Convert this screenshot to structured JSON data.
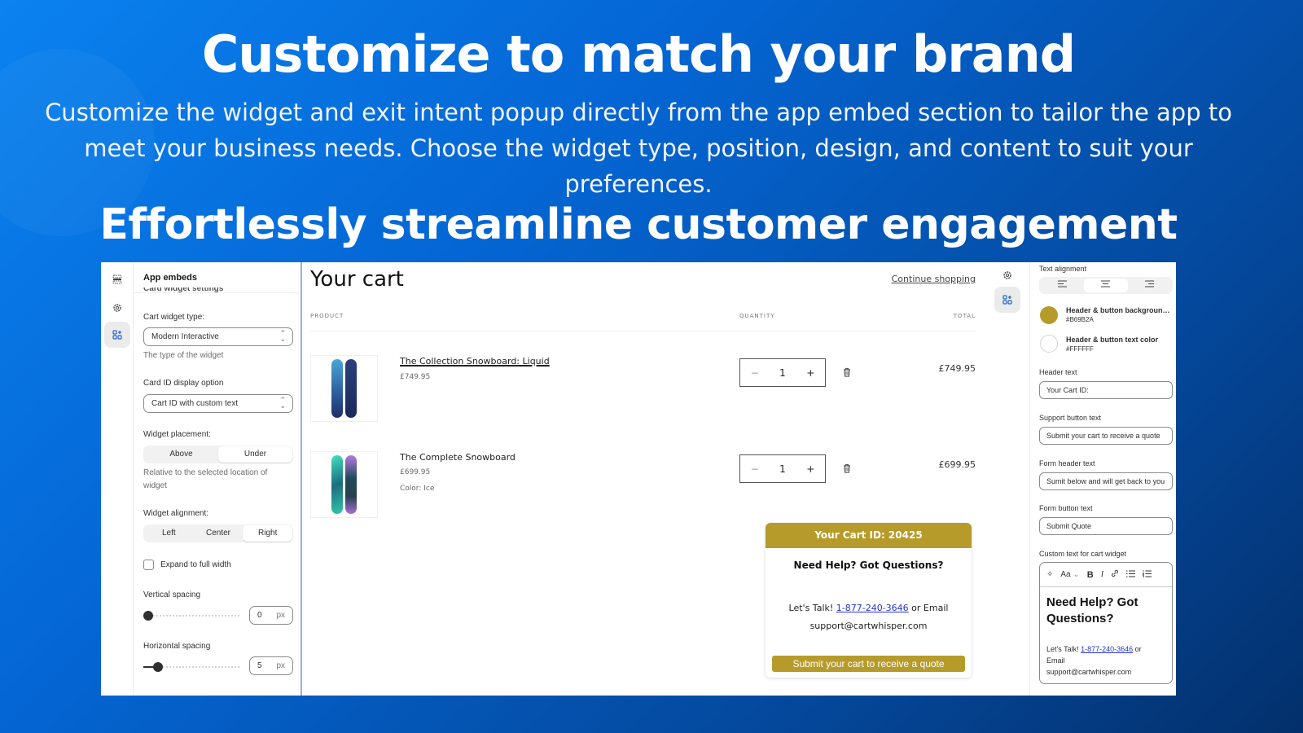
{
  "hero": {
    "title": "Customize to match your brand",
    "description": "Customize the widget and exit intent popup directly from the app embed section to tailor the app to meet your business needs. Choose the widget type, position, design, and content to suit your preferences.",
    "subtitle": "Effortlessly streamline customer engagement"
  },
  "left_rail": {
    "icons": [
      "sections-icon",
      "gear-icon",
      "apps-add-icon"
    ],
    "active": "apps-add-icon"
  },
  "settings": {
    "header": "App embeds",
    "cut_heading": "Card widget settings",
    "cart_widget_type": {
      "label": "Cart widget type:",
      "value": "Modern Interactive",
      "help": "The type of the widget"
    },
    "card_id_option": {
      "label": "Card ID display option",
      "value": "Cart ID with custom text"
    },
    "placement": {
      "label": "Widget placement:",
      "options": [
        "Above",
        "Under"
      ],
      "selected": "Under",
      "help": "Relative to the selected location of widget"
    },
    "alignment": {
      "label": "Widget alignment:",
      "options": [
        "Left",
        "Center",
        "Right"
      ],
      "selected": "Right"
    },
    "expand": {
      "label": "Expand to full width",
      "checked": false
    },
    "vertical_spacing": {
      "label": "Vertical spacing",
      "value": "0",
      "unit": "px"
    },
    "horizontal_spacing": {
      "label": "Horizontal spacing",
      "value": "5",
      "unit": "px"
    },
    "chevron": "⌃⌄"
  },
  "cart": {
    "title": "Your cart",
    "continue": "Continue shopping",
    "columns": {
      "product": "PRODUCT",
      "quantity": "QUANTITY",
      "total": "TOTAL"
    },
    "items": [
      {
        "name": "The Collection Snowboard: Liquid",
        "price": "£749.95",
        "variant": "",
        "qty": "1",
        "total": "£749.95"
      },
      {
        "name": "The Complete Snowboard",
        "price": "£699.95",
        "variant": "Color: Ice",
        "qty": "1",
        "total": "£699.95"
      }
    ],
    "qty_minus": "−",
    "qty_plus": "+",
    "trash": "🗑"
  },
  "widget": {
    "header": "Your Cart ID: 20425",
    "heading": "Need Help? Got Questions?",
    "talk_prefix": "Let's Talk! ",
    "phone": "1-877-240-3646",
    "talk_suffix": " or Email",
    "email": "support@cartwhisper.com",
    "button": "Submit your cart to receive a quote",
    "brand_color": "#B69B2A"
  },
  "right_panel": {
    "text_alignment_label": "Text alignment",
    "align_options": [
      "≡",
      "≡",
      "≡"
    ],
    "align_selected": 1,
    "bg_color": {
      "label": "Header & button background color",
      "value": "#B69B2A"
    },
    "text_color": {
      "label": "Header & button text color",
      "value": "#FFFFFF"
    },
    "header_text": {
      "label": "Header text",
      "value": "Your Cart ID:"
    },
    "support_button_text": {
      "label": "Support button text",
      "value": "Submit your cart to receive a quote"
    },
    "form_header_text": {
      "label": "Form header text",
      "value": "Sumit below and will get back to you"
    },
    "form_button_text": {
      "label": "Form button text",
      "value": "Submit Quote"
    },
    "custom_text": {
      "label": "Custom text for cart widget",
      "toolbar": {
        "magic": "✧",
        "font": "Aa",
        "caret": "⌄",
        "bold": "B",
        "italic": "I",
        "link": "🔗",
        "bullets": "☰",
        "numbers": "☷"
      },
      "heading": "Need Help? Got Questions?",
      "talk_prefix": "Let's Talk! ",
      "phone": "1-877-240-3646",
      "talk_suffix": " or",
      "email_label": "Email",
      "email": "support@cartwhisper.com"
    }
  }
}
